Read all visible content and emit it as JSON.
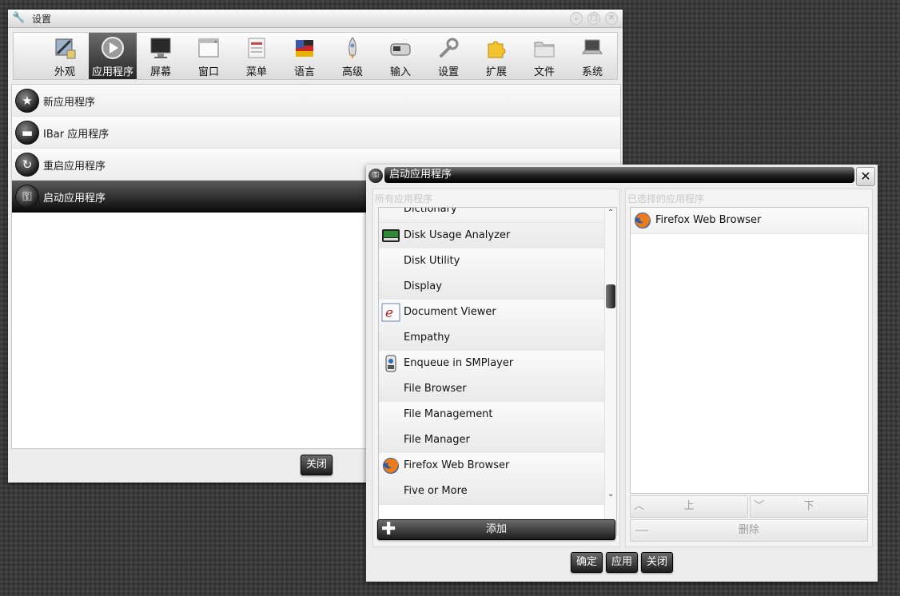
{
  "settings_window": {
    "title": "设置",
    "toolbar": [
      {
        "label": "外观",
        "icon": "appearance-icon"
      },
      {
        "label": "应用程序",
        "icon": "play-icon",
        "active": true
      },
      {
        "label": "屏幕",
        "icon": "monitor-icon"
      },
      {
        "label": "窗口",
        "icon": "window-icon"
      },
      {
        "label": "菜单",
        "icon": "menu-icon"
      },
      {
        "label": "语言",
        "icon": "flag-icon"
      },
      {
        "label": "高级",
        "icon": "rocket-icon"
      },
      {
        "label": "输入",
        "icon": "mouse-icon"
      },
      {
        "label": "设置",
        "icon": "wrench-icon"
      },
      {
        "label": "扩展",
        "icon": "puzzle-icon"
      },
      {
        "label": "文件",
        "icon": "folder-icon"
      },
      {
        "label": "系统",
        "icon": "laptop-icon"
      }
    ],
    "rows": [
      {
        "label": "新应用程序",
        "icon": "star-icon",
        "glyph": "★"
      },
      {
        "label": "IBar 应用程序",
        "icon": "minus-icon",
        "glyph": "▬"
      },
      {
        "label": "重启应用程序",
        "icon": "restart-icon",
        "glyph": "↻"
      },
      {
        "label": "启动应用程序",
        "icon": "key-icon",
        "glyph": "⚿",
        "selected": true
      }
    ],
    "close_label": "关闭"
  },
  "startup_dialog": {
    "title": "启动应用程序",
    "all_apps_label": "所有应用程序",
    "selected_apps_label": "已选择的应用程序",
    "apps": [
      {
        "name": "Dictionary",
        "icon": ""
      },
      {
        "name": "Disk Usage Analyzer",
        "icon": "disk-usage-icon"
      },
      {
        "name": "Disk Utility",
        "icon": ""
      },
      {
        "name": "Display",
        "icon": ""
      },
      {
        "name": "Document Viewer",
        "icon": "document-viewer-icon"
      },
      {
        "name": "Empathy",
        "icon": ""
      },
      {
        "name": "Enqueue in SMPlayer",
        "icon": "smplayer-icon"
      },
      {
        "name": "File Browser",
        "icon": ""
      },
      {
        "name": "File Management",
        "icon": ""
      },
      {
        "name": "File Manager",
        "icon": ""
      },
      {
        "name": "Firefox Web Browser",
        "icon": "firefox-icon"
      },
      {
        "name": "Five or More",
        "icon": ""
      }
    ],
    "selected_apps": [
      {
        "name": "Firefox Web Browser",
        "icon": "firefox-icon"
      }
    ],
    "add_label": "添加",
    "up_label": "上",
    "down_label": "下",
    "remove_label": "删除",
    "ok_label": "确定",
    "apply_label": "应用",
    "close_label": "关闭"
  }
}
